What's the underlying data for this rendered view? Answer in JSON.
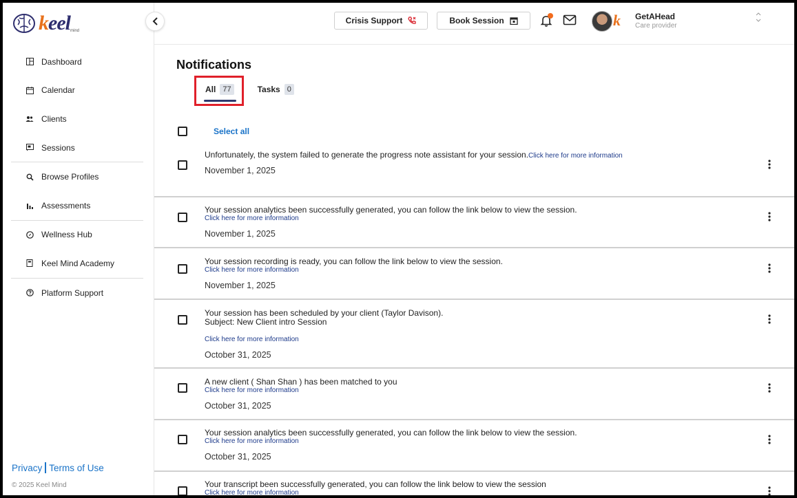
{
  "app": {
    "logo_text_k": "k",
    "logo_text_rest": "eel",
    "logo_sub": "mind"
  },
  "sidebar": {
    "items": [
      {
        "label": "Dashboard",
        "icon": "dashboard-icon"
      },
      {
        "label": "Calendar",
        "icon": "calendar-icon"
      },
      {
        "label": "Clients",
        "icon": "clients-icon"
      },
      {
        "label": "Sessions",
        "icon": "sessions-icon"
      },
      {
        "label": "Browse Profiles",
        "icon": "search-icon"
      },
      {
        "label": "Assessments",
        "icon": "bar-chart-icon"
      },
      {
        "label": "Wellness Hub",
        "icon": "compass-icon"
      },
      {
        "label": "Keel Mind Academy",
        "icon": "book-icon"
      },
      {
        "label": "Platform Support",
        "icon": "help-icon"
      }
    ],
    "privacy": "Privacy",
    "terms": "Terms of Use",
    "copyright": "© 2025 Keel Mind"
  },
  "header": {
    "crisis_support": "Crisis Support",
    "book_session": "Book Session",
    "user_name": "GetAHead",
    "user_role": "Care provider",
    "accent_orange": "#f26b1d"
  },
  "main": {
    "title": "Notifications",
    "tabs": [
      {
        "label": "All",
        "count": "77"
      },
      {
        "label": "Tasks",
        "count": "0"
      }
    ],
    "select_all": "Select all",
    "notifications": [
      {
        "message": "Unfortunately, the system failed to generate the progress note assistant for your session.",
        "inline_link": "Click here for more information",
        "date": "November 1, 2025"
      },
      {
        "message": "Your session analytics been successfully generated, you can follow the link below to view the session.",
        "link": "Click here for more information",
        "date": "November 1, 2025"
      },
      {
        "message": "Your session recording is ready, you can follow the link below to view the session.",
        "link": "Click here for more information",
        "date": "November 1, 2025"
      },
      {
        "message": "Your session has been scheduled by your client (Taylor Davison).",
        "subject": "Subject: New Client intro Session",
        "link": "Click here for more information",
        "date": "October 31, 2025"
      },
      {
        "message": "A new client ( Shan Shan ) has been matched to you",
        "link": "Click here for more information",
        "date": "October 31, 2025"
      },
      {
        "message": "Your session analytics been successfully generated, you can follow the link below to view the session.",
        "link": "Click here for more information",
        "date": "October 31, 2025"
      },
      {
        "message": "Your transcript been successfully generated, you can follow the link below to view the session",
        "link": "Click here for more information",
        "date": ""
      }
    ]
  }
}
